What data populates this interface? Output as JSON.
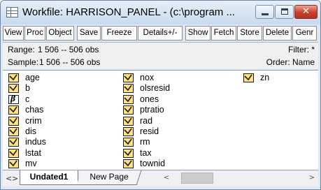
{
  "window": {
    "title": "Workfile: HARRISON_PANEL - (c:\\program ...",
    "controls": {
      "minimize": "minimize",
      "maximize": "maximize",
      "close": "✕"
    }
  },
  "toolbar": {
    "buttons": [
      "View",
      "Proc",
      "Object",
      "Save",
      "Freeze",
      "Details+/-",
      "Show",
      "Fetch",
      "Store",
      "Delete",
      "Genr"
    ]
  },
  "info": {
    "range_label": "Range:",
    "range_value": "1 506  --  506 obs",
    "filter": "Filter: *",
    "sample_label": "Sample:",
    "sample_value": "1 506  --  506 obs",
    "order": "Order: Name"
  },
  "objects": [
    {
      "name": "age",
      "icon": "series-icon"
    },
    {
      "name": "b",
      "icon": "series-icon"
    },
    {
      "name": "c",
      "icon": "coefficient-icon"
    },
    {
      "name": "chas",
      "icon": "series-icon"
    },
    {
      "name": "crim",
      "icon": "series-icon"
    },
    {
      "name": "dis",
      "icon": "series-icon"
    },
    {
      "name": "indus",
      "icon": "series-icon"
    },
    {
      "name": "lstat",
      "icon": "series-icon"
    },
    {
      "name": "mv",
      "icon": "series-icon"
    },
    {
      "name": "nox",
      "icon": "series-icon"
    },
    {
      "name": "olsresid",
      "icon": "series-icon"
    },
    {
      "name": "ones",
      "icon": "series-icon"
    },
    {
      "name": "ptratio",
      "icon": "series-icon"
    },
    {
      "name": "rad",
      "icon": "series-icon"
    },
    {
      "name": "resid",
      "icon": "series-icon"
    },
    {
      "name": "rm",
      "icon": "series-icon"
    },
    {
      "name": "tax",
      "icon": "series-icon"
    },
    {
      "name": "townid",
      "icon": "series-icon"
    },
    {
      "name": "zn",
      "icon": "series-icon"
    }
  ],
  "coef_glyph": "β",
  "tabs": {
    "prev": "<",
    "next": ">",
    "active": "Undated1",
    "other": "New Page",
    "scroll_left": "<",
    "scroll_right": ">"
  },
  "colors": {
    "series_icon_fill": "#ffe27a",
    "close_button": "#c8412c"
  }
}
